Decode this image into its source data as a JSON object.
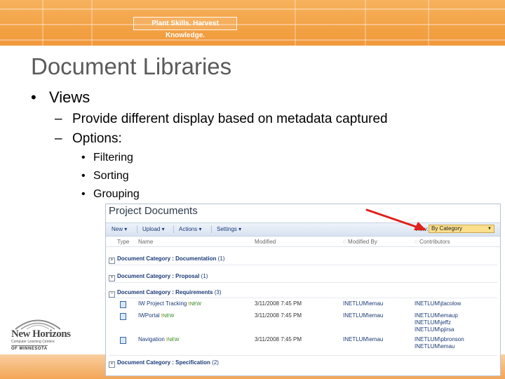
{
  "banner": {
    "tagline": "Plant Skills. Harvest Knowledge."
  },
  "slide": {
    "title": "Document Libraries",
    "bullet1": "Views",
    "sub": [
      "Provide different display based on metadata captured",
      "Options:"
    ],
    "options": [
      "Filtering",
      "Sorting",
      "Grouping"
    ]
  },
  "logo": {
    "line1": "New Horizons",
    "line2": "Computer Learning Centers",
    "line3": "OF MINNESOTA"
  },
  "screenshot": {
    "title": "Project Documents",
    "toolbar": {
      "new": "New",
      "upload": "Upload",
      "actions": "Actions",
      "settings": "Settings",
      "view_label": "View:",
      "view_value": "By Category"
    },
    "columns": {
      "type": "Type",
      "name": "Name",
      "modified": "Modified",
      "modified_by": "Modified By",
      "contributors": "Contributors"
    },
    "groups": [
      {
        "label": "Document Category : Documentation",
        "count": "(1)"
      },
      {
        "label": "Document Category : Proposal",
        "count": "(1)"
      },
      {
        "label": "Document Category : Requirements",
        "count": "(3)"
      },
      {
        "label": "Document Category : Specification",
        "count": "(2)"
      }
    ],
    "rows": [
      {
        "name": "IW Project Tracking",
        "new": "NEW",
        "modified": "3/11/2008 7:45 PM",
        "modified_by": "INETLUM\\emau",
        "contributors": [
          "INETLUM\\jtacolow"
        ]
      },
      {
        "name": "IWPortal",
        "new": "NEW",
        "modified": "3/11/2008 7:45 PM",
        "modified_by": "INETLUM\\emau",
        "contributors": [
          "INETLUM\\emaup",
          "INETLUM\\jeffz",
          "INETLUM\\pjirsa"
        ]
      },
      {
        "name": "Navigation",
        "new": "NEW",
        "modified": "3/11/2008 7:45 PM",
        "modified_by": "INETLUM\\emau",
        "contributors": [
          "INETLUM\\pbronson",
          "INETLUM\\emau"
        ]
      }
    ]
  },
  "colors": {
    "banner": "#f3a347",
    "title": "#5a5a5a",
    "link": "#1b3a78",
    "view_highlight": "#fbdf8b",
    "arrow": "#e0201b"
  }
}
